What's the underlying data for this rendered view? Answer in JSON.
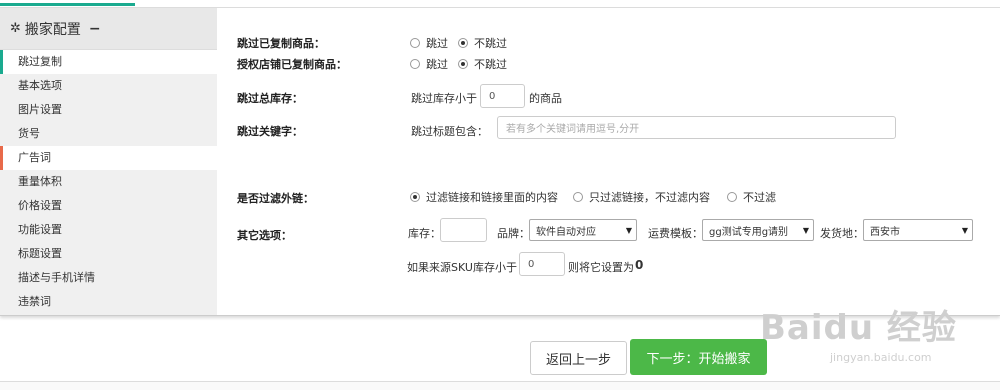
{
  "sidebar": {
    "title": "搬家配置",
    "items": [
      {
        "label": "跳过复制"
      },
      {
        "label": "基本选项"
      },
      {
        "label": "图片设置"
      },
      {
        "label": "货号"
      },
      {
        "label": "广告词"
      },
      {
        "label": "重量体积"
      },
      {
        "label": "价格设置"
      },
      {
        "label": "功能设置"
      },
      {
        "label": "标题设置"
      },
      {
        "label": "描述与手机详情"
      },
      {
        "label": "违禁词"
      }
    ]
  },
  "form": {
    "skip_copied": {
      "label": "跳过已复制商品：",
      "opt_skip": "跳过",
      "opt_noskip": "不跳过",
      "selected": "不跳过"
    },
    "skip_auth_copied": {
      "label": "授权店铺已复制商品：",
      "opt_skip": "跳过",
      "opt_noskip": "不跳过",
      "selected": "不跳过"
    },
    "skip_stock": {
      "label": "跳过总库存：",
      "prefix": "跳过库存小于",
      "value": "0",
      "suffix": "的商品"
    },
    "skip_keyword": {
      "label": "跳过关键字：",
      "prefix": "跳过标题包含：",
      "placeholder": "若有多个关键词请用逗号,分开"
    },
    "filter_links": {
      "label": "是否过滤外链：",
      "opt1": "过滤链接和链接里面的内容",
      "opt2": "只过滤链接，不过滤内容",
      "opt3": "不过滤",
      "selected": "过滤链接和链接里面的内容"
    },
    "other": {
      "label": "其它选项：",
      "stock_label": "库存：",
      "stock_value": "",
      "brand_label": "品牌：",
      "brand_value": "软件自动对应",
      "shipping_label": "运费模板：",
      "shipping_value": "gg测试专用g请别",
      "ship_from_label": "发货地：",
      "ship_from_value": "西安市",
      "sku_prefix": "如果来源SKU库存小于",
      "sku_value": "0",
      "sku_suffix": "则将它设置为",
      "sku_set_to": "0"
    }
  },
  "buttons": {
    "back": "返回上一步",
    "next": "下一步：开始搬家"
  },
  "watermark": {
    "brand": "Baidu 经验",
    "url": "jingyan.baidu.com"
  },
  "colors": {
    "accent": "#1aaa8f",
    "next_button": "#4cb848",
    "marker": "#e86a4a"
  }
}
